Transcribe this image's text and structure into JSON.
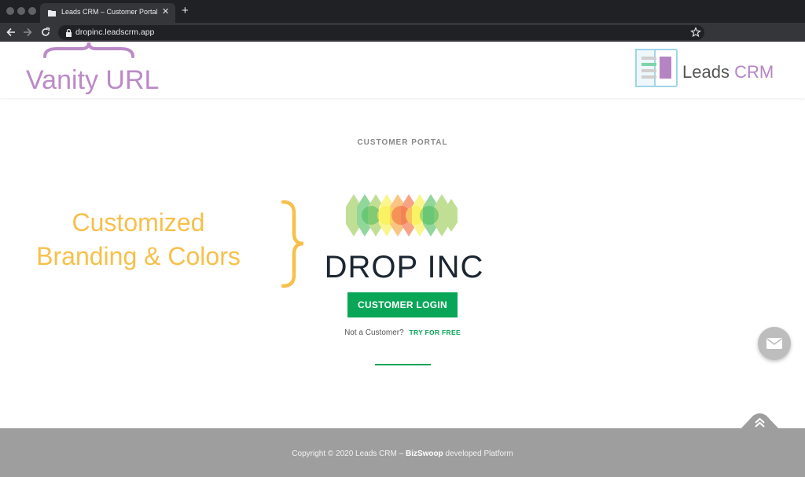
{
  "browser": {
    "tab_title": "Leads CRM – Customer Portal",
    "tab_close": "✕",
    "new_tab": "+",
    "url": "dropinc.leadscrm.app"
  },
  "header": {
    "logo_text_main": "Leads ",
    "logo_text_accent": "CRM"
  },
  "annotations": {
    "vanity_url": "Vanity URL",
    "branding_line1": "Customized",
    "branding_line2": "Branding & Colors",
    "purple_color": "#bb8ac7",
    "yellow_color": "#f7c04a"
  },
  "main": {
    "portal_label": "CUSTOMER PORTAL",
    "company_name": "DROP INC",
    "login_button": "CUSTOMER LOGIN",
    "not_customer": "Not a Customer?",
    "try_free": "TRY FOR FREE"
  },
  "footer": {
    "copyright": "Copyright © 2020 Leads CRM – ",
    "brand": "BizSwoop",
    "suffix": " developed Platform"
  },
  "colors": {
    "accent_green": "#09a658",
    "footer_bg": "#9e9e9e",
    "logo_purple": "#b684c4"
  },
  "icons": [
    "folder-icon",
    "close-icon",
    "plus-icon",
    "back-arrow-icon",
    "forward-arrow-icon",
    "reload-icon",
    "lock-icon",
    "star-icon",
    "leads-crm-logo-icon",
    "drop-inc-logo-icon",
    "envelope-icon",
    "double-chevron-up-icon"
  ]
}
